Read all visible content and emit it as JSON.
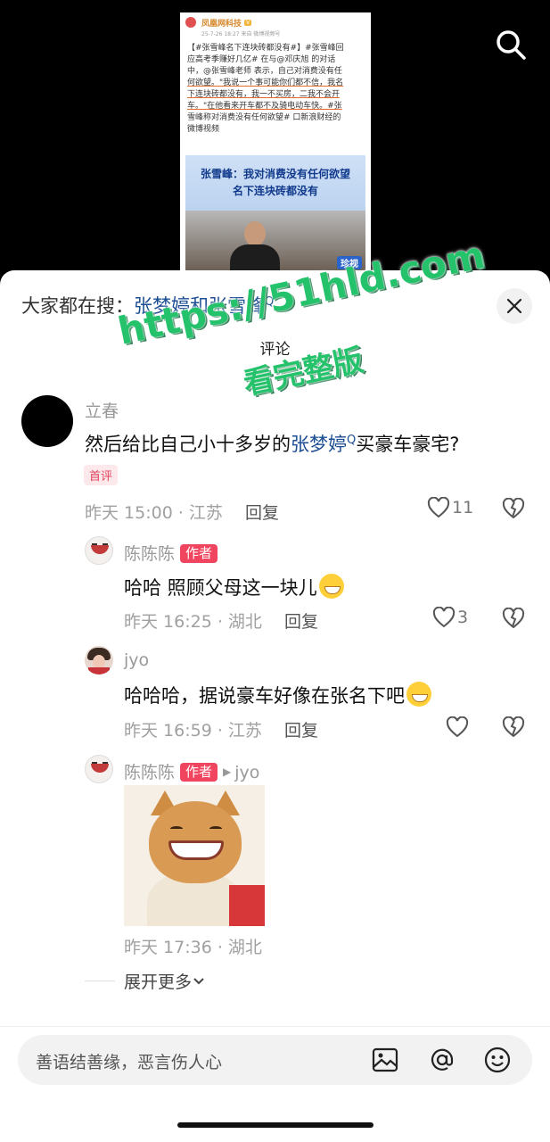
{
  "post_preview": {
    "source": "凤凰网科技",
    "vip_badge": "V",
    "meta": "25-7-26 18:27  来自 微博视频号",
    "body_lines": [
      "【#张雪峰名下连块砖都没有#】#张雪峰回",
      "应高考季赚好几亿# 在与@邓庆旭 的对话",
      "中，@张雪峰老师 表示，自己对消费没有任",
      "何欲望。\"我说一个事可能你们都不信，我名",
      "下连块砖都没有，我一不买房，二我不会开",
      "车。\"在他看来开车都不及骑电动车快。#张",
      "雪峰称对消费没有任何欲望# 口新浪财经的",
      "微博视频"
    ],
    "banner_line1": "张雪峰：我对消费没有任何欲望",
    "banner_line2": "名下连块砖都没有",
    "video_tag": "珍视"
  },
  "sheet": {
    "search_prefix": "大家都在搜：",
    "search_term": "张梦婷和张雪峰",
    "title": "评论"
  },
  "comments": [
    {
      "author": "立春",
      "text_before": "然后给比自己小十多岁的",
      "text_link": "张梦婷",
      "text_after": "买豪车豪宅?",
      "badge": "首评",
      "time_location": "昨天 15:00 · 江苏",
      "reply_label": "回复",
      "likes": "11"
    },
    {
      "author": "陈陈陈",
      "author_badge": "作者",
      "text": "哈哈 照顾父母这一块儿",
      "time_location": "昨天 16:25 · 湖北",
      "reply_label": "回复",
      "likes": "3"
    },
    {
      "author": "jyo",
      "text": "哈哈哈，据说豪车好像在张名下吧",
      "time_location": "昨天 16:59 · 江苏",
      "reply_label": "回复",
      "likes": ""
    },
    {
      "author": "陈陈陈",
      "author_badge": "作者",
      "reply_to": "jyo",
      "time_location": "昨天 17:36 · 湖北"
    }
  ],
  "expand_more": "展开更多",
  "input": {
    "placeholder": "善语结善缘，恶言伤人心"
  },
  "watermark": {
    "url": "https://51hld.com",
    "text": "看完整版",
    "color": "#24c26b"
  },
  "colors": {
    "link": "#1c4e93",
    "author_badge": "#f0445f",
    "first_badge_text": "#e0435d"
  }
}
